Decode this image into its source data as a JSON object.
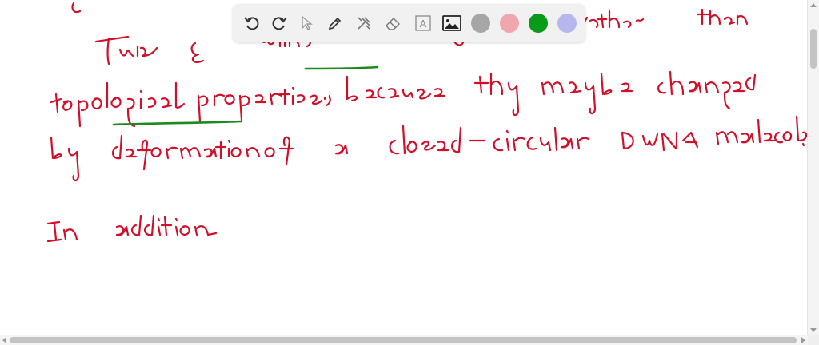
{
  "colors": {
    "ink": "#d0102a",
    "underline": "#1e8a1e",
    "swatches": [
      "#a6a6a6",
      "#efa6ad",
      "#0a9a1a",
      "#b7b7ee"
    ]
  },
  "toolbar": {
    "tools": [
      {
        "name": "undo-icon"
      },
      {
        "name": "redo-icon"
      },
      {
        "name": "pointer-icon"
      },
      {
        "name": "pen-icon"
      },
      {
        "name": "tools-icon"
      },
      {
        "name": "eraser-icon"
      },
      {
        "name": "text-icon",
        "glyph": "A"
      },
      {
        "name": "image-icon"
      }
    ],
    "swatch_names": [
      "gray-swatch",
      "pink-swatch",
      "green-swatch",
      "lavender-swatch"
    ]
  }
}
